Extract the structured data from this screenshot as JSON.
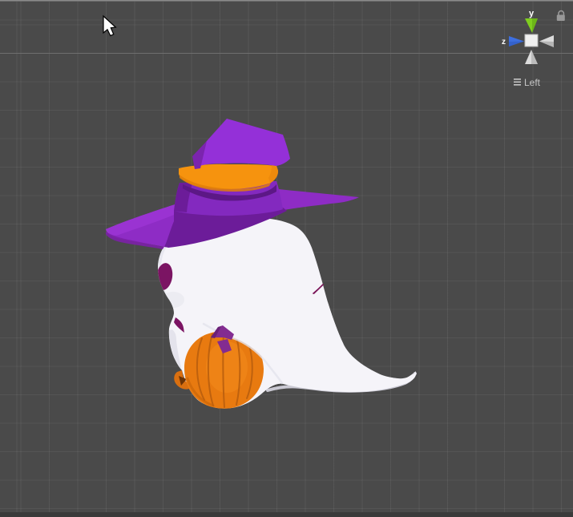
{
  "scene": {
    "type": "unity-scene-view",
    "background": "#4A4A4A",
    "grid_line": "#565656",
    "horizon_line": "#6F6F6F",
    "top_edge": "#9A9A9A",
    "bottom_bar": "#3A3A3A"
  },
  "gizmo": {
    "y_label": "y",
    "z_label": "z",
    "view_label": "Left",
    "icons": [
      "lock-icon",
      "hamburger-menu-icon",
      "axis-cone-icon",
      "axis-cube-icon"
    ],
    "colors": {
      "y_axis": "#7FCE1F",
      "y_axis_dark": "#5FA514",
      "z_axis": "#3D6FE0",
      "z_axis_dark": "#2C56B8",
      "cube": "#F0F0F0",
      "cube_border": "#B9B9B9",
      "neg_axis": "#DCDCDC",
      "neg_axis_dark": "#9B9B9B",
      "label_text": "#FFFFFF",
      "view_text": "#C6C6C6",
      "lock": "#989898"
    }
  },
  "model": {
    "label": "ghost-with-witch-hat-on-pumpkin",
    "colors": {
      "ghost": "#F5F4F9",
      "ghost_shade": "#E4E3EC",
      "ghost_edge": "#D8D7E2",
      "eye": "#7B1463",
      "mouth": "#7B1463",
      "slash": "#7A1458",
      "hat_cone": "#9430D8",
      "hat_cone_side": "#7B24AE",
      "hat_crown": "#8329BF",
      "hat_crown_shadow": "#5C1886",
      "hat_brim": "#8E2CC5",
      "hat_brim_left": "#9A33D2",
      "hat_brim_left_edge": "#7C20A8",
      "hat_brim_under": "#6C1C99",
      "band": "#F6930E",
      "band_shadow": "#E07F08",
      "band_cap": "#ED8A0C",
      "pumpkin": "#E87A10",
      "pumpkin_light": "#F28A1C",
      "pumpkin_ridge": "#BA5F0E",
      "pumpkin_shadow": "#C46208",
      "pumpkin_knob": "#D96F10",
      "pumpkin_knob_dark": "#6B3305",
      "stem": "#832C91",
      "stem_dark": "#6B2178"
    }
  },
  "cursor": {
    "fill": "#FFFFFF",
    "outline": "#000000"
  }
}
